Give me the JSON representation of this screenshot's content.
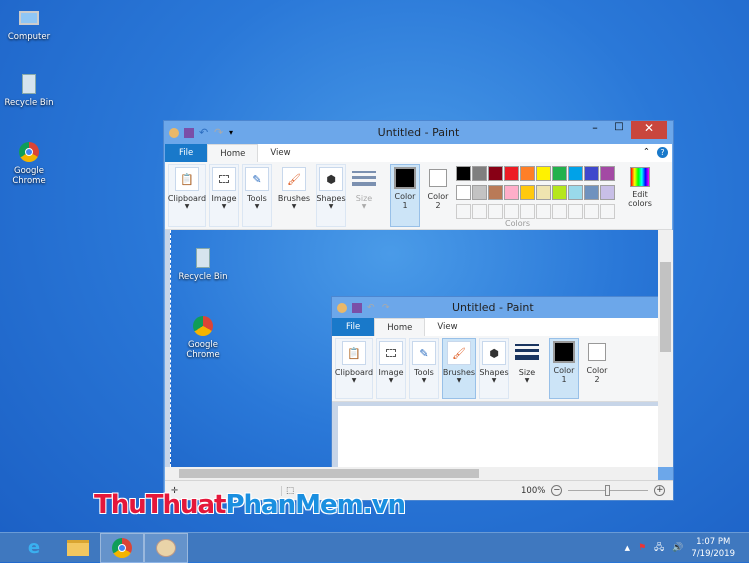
{
  "desktop": {
    "icons": [
      {
        "label": "Computer"
      },
      {
        "label": "Recycle Bin"
      },
      {
        "label": "Google Chrome"
      }
    ]
  },
  "paint": {
    "title": "Untitled - Paint",
    "tabs": {
      "file": "File",
      "home": "Home",
      "view": "View"
    },
    "groups": {
      "clipboard": "Clipboard",
      "image": "Image",
      "tools": "Tools",
      "brushes": "Brushes",
      "shapes": "Shapes",
      "size": "Size",
      "color1": "Color\n1",
      "color2": "Color\n2",
      "edit_colors": "Edit colors",
      "colors": "Colors"
    },
    "palette": [
      "#000000",
      "#7f7f7f",
      "#880015",
      "#ed1c24",
      "#ff7f27",
      "#fff200",
      "#22b14c",
      "#00a2e8",
      "#3f48cc",
      "#a349a4",
      "#ffffff",
      "#c3c3c3",
      "#b97a57",
      "#ffaec9",
      "#ffc90e",
      "#efe4b0",
      "#b5e61d",
      "#99d9ea",
      "#7092be",
      "#c8bfe7"
    ],
    "zoom": "100%"
  },
  "pasted": {
    "icons": [
      {
        "label": "Recycle Bin"
      },
      {
        "label": "Google Chrome"
      }
    ]
  },
  "watermark": {
    "part1": "ThuThuat",
    "part2": "PhanMem",
    "part3": ".vn"
  },
  "taskbar": {
    "time": "1:07 PM",
    "date": "7/19/2019"
  }
}
